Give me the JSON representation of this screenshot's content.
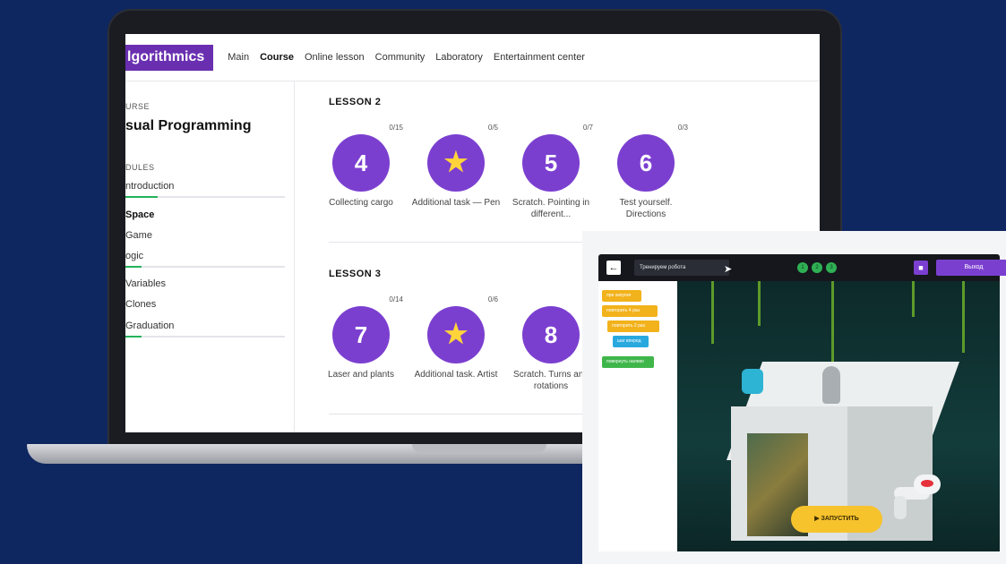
{
  "laptop": {
    "logo": "lgorithmics",
    "nav": [
      "Main",
      "Course",
      "Online lesson",
      "Community",
      "Laboratory",
      "Entertainment center"
    ],
    "sidebar": {
      "caption": "URSE",
      "title": "sual Programming",
      "modules_caption": "DULES",
      "modules": [
        {
          "label": "ntroduction",
          "progress": 0.2
        },
        {
          "label": "Space",
          "progress": null
        },
        {
          "label": "Game",
          "progress": null
        },
        {
          "label": "ogic",
          "progress": 0.1
        },
        {
          "label": "Variables",
          "progress": null
        },
        {
          "label": "Clones",
          "progress": null
        },
        {
          "label": "Graduation",
          "progress": 0.1
        }
      ]
    },
    "lessons": [
      {
        "title": "LESSON 2",
        "cards": [
          {
            "badge": "4",
            "count": "0/15",
            "label": "Collecting cargo"
          },
          {
            "badge": "star",
            "count": "0/5",
            "label": "Additional task — Pen"
          },
          {
            "badge": "5",
            "count": "0/7",
            "label": "Scratch. Pointing in different..."
          },
          {
            "badge": "6",
            "count": "0/3",
            "label": "Test yourself. Directions"
          }
        ]
      },
      {
        "title": "LESSON 3",
        "cards": [
          {
            "badge": "7",
            "count": "0/14",
            "label": "Laser and plants"
          },
          {
            "badge": "star",
            "count": "0/6",
            "label": "Additional task. Artist"
          },
          {
            "badge": "8",
            "count": "",
            "label": "Scratch. Turns and rotations"
          }
        ]
      }
    ]
  },
  "overlay": {
    "task_field": "Тренируем робота",
    "steps": [
      "1",
      "2",
      "3"
    ],
    "exit_label": "Выход",
    "run_label": "▶ ЗАПУСТИТЬ",
    "blocks": [
      {
        "text": "при запуске",
        "color": "#f2b21b"
      },
      {
        "text": "повторить 4 раз",
        "color": "#f2b21b"
      },
      {
        "text": "повторить 2 раз",
        "color": "#f2b21b"
      },
      {
        "text": "шаг вперед",
        "color": "#29a9df"
      },
      {
        "text": "повернуть налево",
        "color": "#3fb64a"
      }
    ]
  },
  "colors": {
    "background": "#0f2760",
    "accent": "#7b3fd0",
    "progress": "#22b35b",
    "star": "#ffd43a"
  }
}
